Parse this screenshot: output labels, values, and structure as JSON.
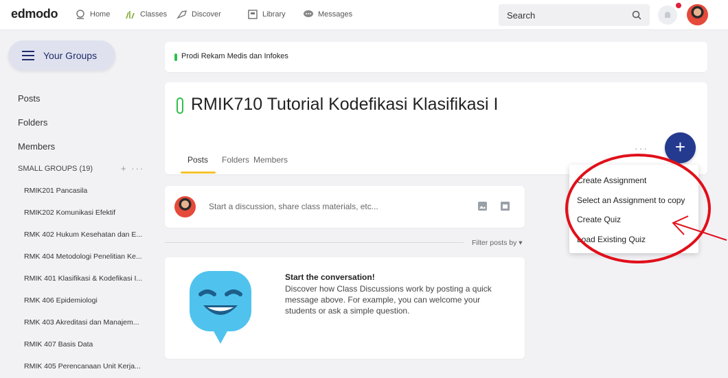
{
  "nav": {
    "logo": "edmodo",
    "items": [
      {
        "label": "Home",
        "icon": "home-icon"
      },
      {
        "label": "Classes",
        "icon": "classes-icon"
      },
      {
        "label": "Discover",
        "icon": "discover-icon"
      },
      {
        "label": "Library",
        "icon": "library-icon"
      },
      {
        "label": "Messages",
        "icon": "messages-icon"
      }
    ],
    "search_placeholder": "Search"
  },
  "sidebar": {
    "groups_button": "Your Groups",
    "links": [
      "Posts",
      "Folders",
      "Members"
    ],
    "small_groups_label": "SMALL GROUPS (19)",
    "small_groups_actions": "+ ···",
    "groups": [
      "RMIK201 Pancasila",
      "RMIK202 Komunikasi Efektif",
      "RMK 402 Hukum Kesehatan dan E...",
      "RMK 404 Metodologi Penelitian Ke...",
      "RMIK 401 Klasifikasi & Kodefikasi I...",
      "RMK 406 Epidemiologi",
      "RMK 403 Akreditasi dan Manajem...",
      "RMIK 407 Basis Data",
      "RMIK 405 Perencanaan Unit Kerja..."
    ]
  },
  "breadcrumb": "Prodi Rekam Medis dan Infokes",
  "class": {
    "title": "RMIK710 Tutorial Kodefikasi Klasifikasi I",
    "tabs": [
      "Posts",
      "Folders",
      "Members"
    ],
    "more": "···",
    "add_button": "+"
  },
  "dropdown": {
    "items": [
      "Create Assignment",
      "Select an Assignment to copy",
      "Create Quiz",
      "Load Existing Quiz"
    ]
  },
  "compose": {
    "placeholder": "Start a discussion, share class materials, etc..."
  },
  "filter_label": "Filter posts by ▾",
  "conversation": {
    "title": "Start the conversation!",
    "body": "Discover how Class Discussions work by posting a quick message above. For example, you can welcome your students or ask a simple question."
  },
  "colors": {
    "accent_navy": "#243a8f",
    "green_marker": "#2fbf4c",
    "tab_underline": "#f6c12b",
    "annotation_red": "#e0101a",
    "mascot_blue": "#4fc3ee"
  }
}
